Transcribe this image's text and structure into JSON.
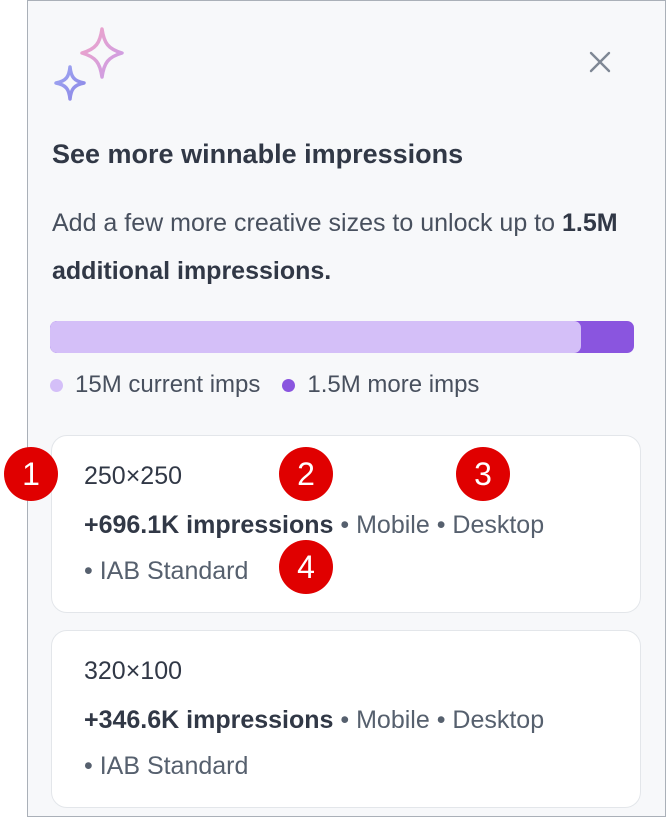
{
  "window": {
    "close_icon": "close-icon",
    "logo_icon": "sparkles-icon"
  },
  "header": {
    "title": "See more winnable impressions",
    "desc_prefix": "Add a few more creative sizes to unlock up to ",
    "desc_bold": "1.5M additional impressions."
  },
  "progress": {
    "current_fraction": 0.909,
    "current_color": "#d4bff8",
    "more_color": "#8a55df",
    "legend_current": "15M current imps",
    "legend_more": "1.5M more imps"
  },
  "cards": [
    {
      "size": "250×250",
      "impressions": "+696.1K impressions",
      "tags_inline": " • Mobile • Desktop",
      "tags_wrap": "• IAB Standard"
    },
    {
      "size": "320×100",
      "impressions": "+346.6K impressions",
      "tags_inline": " • Mobile • Desktop",
      "tags_wrap": "• IAB Standard"
    }
  ],
  "annotations": [
    "1",
    "2",
    "3",
    "4"
  ],
  "colors": {
    "annotation": "#e00000",
    "accent": "#8a55df"
  }
}
